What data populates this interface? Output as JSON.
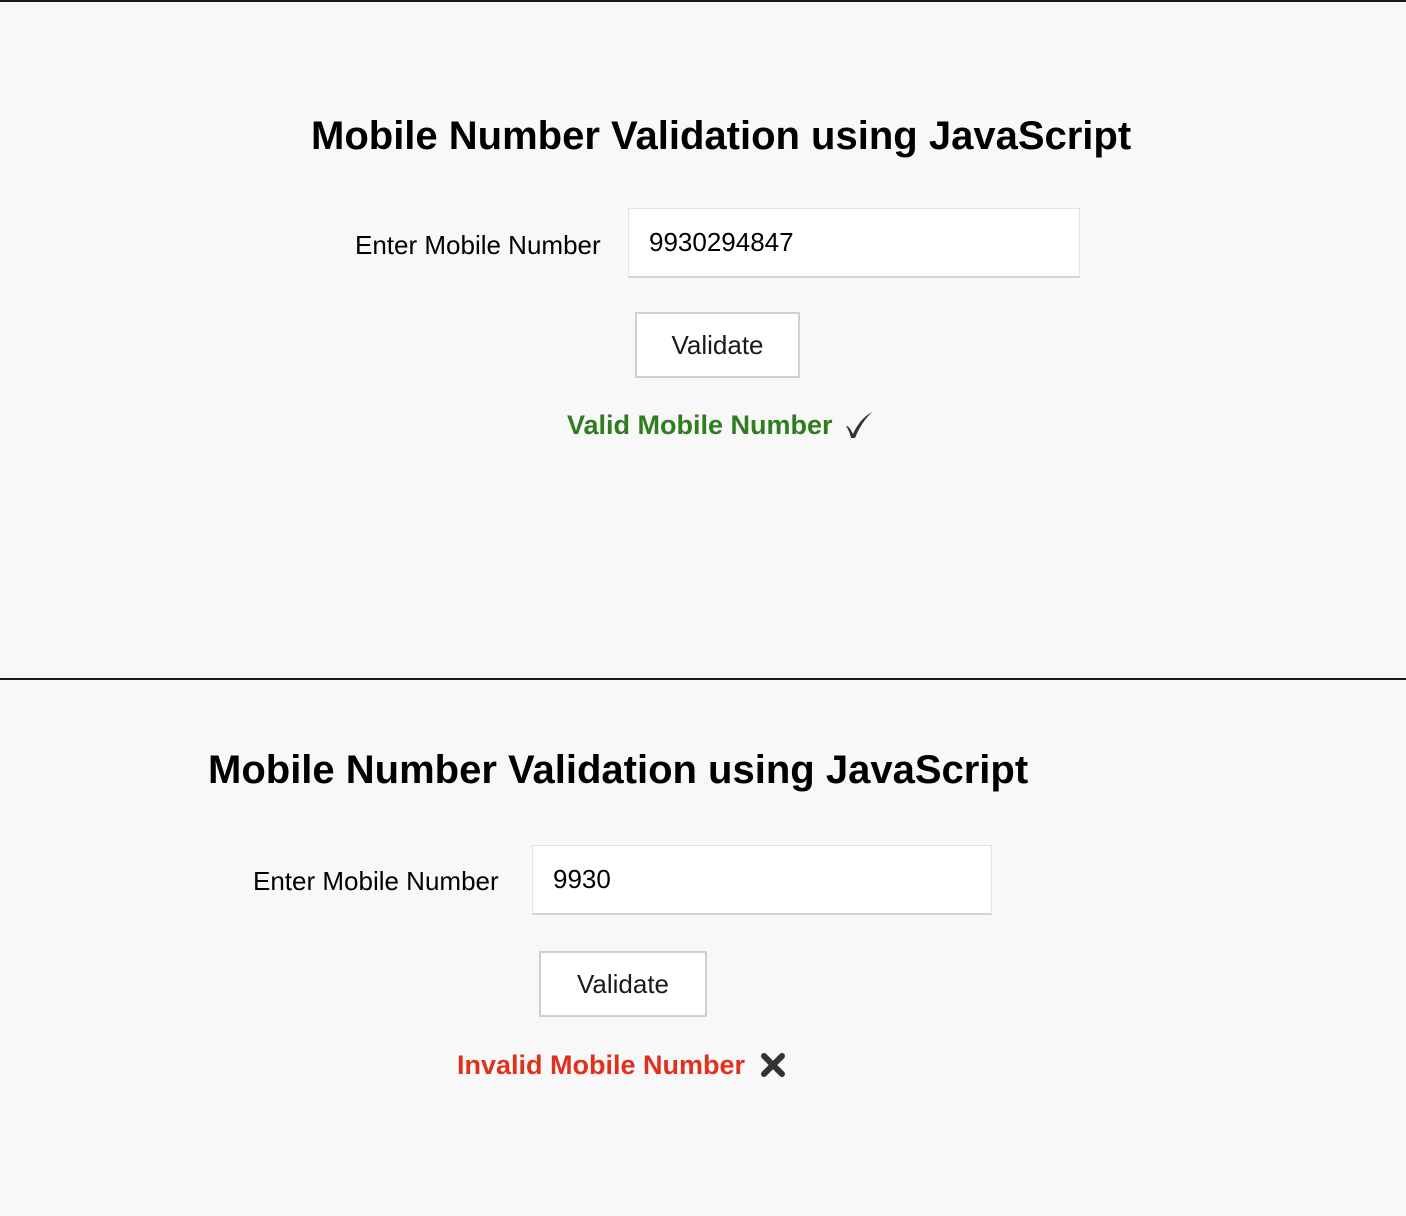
{
  "colors": {
    "background": "#f8f8f8",
    "divider": "#1a1a1a",
    "valid_text": "#2e7d1e",
    "invalid_text": "#e0301e",
    "icon": "#333333"
  },
  "panels": [
    {
      "title": "Mobile Number Validation using JavaScript",
      "label": "Enter Mobile Number",
      "input_value": "9930294847",
      "button_label": "Validate",
      "result_text": "Valid Mobile Number",
      "result_icon": "checkmark-icon"
    },
    {
      "title": "Mobile Number Validation using JavaScript",
      "label": "Enter Mobile Number",
      "input_value": "9930",
      "button_label": "Validate",
      "result_text": "Invalid Mobile Number",
      "result_icon": "cross-icon"
    }
  ]
}
